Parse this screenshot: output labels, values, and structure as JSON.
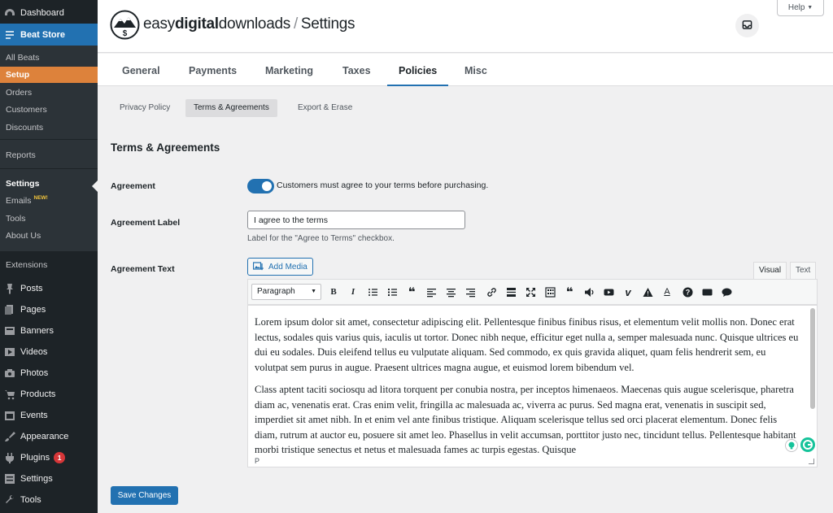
{
  "sidebar": {
    "top": [
      {
        "label": "Dashboard",
        "icon": "dashboard-icon"
      },
      {
        "label": "Beat Store",
        "icon": "store-icon"
      }
    ],
    "submenu": [
      {
        "label": "All Beats"
      },
      {
        "label": "Setup"
      },
      {
        "label": "Orders"
      },
      {
        "label": "Customers"
      },
      {
        "label": "Discounts"
      },
      {
        "label": "Reports"
      },
      {
        "label": "Settings"
      },
      {
        "label": "Emails",
        "badge": "NEW!"
      },
      {
        "label": "Tools"
      },
      {
        "label": "About Us"
      },
      {
        "label": "Extensions"
      }
    ],
    "menu": [
      {
        "label": "Posts",
        "icon": "pin-icon"
      },
      {
        "label": "Pages",
        "icon": "pages-icon"
      },
      {
        "label": "Banners",
        "icon": "banner-icon"
      },
      {
        "label": "Videos",
        "icon": "video-icon"
      },
      {
        "label": "Photos",
        "icon": "camera-icon"
      },
      {
        "label": "Products",
        "icon": "cart-icon"
      },
      {
        "label": "Events",
        "icon": "calendar-icon"
      },
      {
        "label": "Appearance",
        "icon": "brush-icon"
      },
      {
        "label": "Plugins",
        "icon": "plug-icon",
        "badge": "1"
      },
      {
        "label": "Settings",
        "icon": "settings-icon"
      },
      {
        "label": "Tools",
        "icon": "wrench-icon"
      }
    ]
  },
  "header": {
    "brand_light1": "easy",
    "brand_bold": "digital",
    "brand_light2": "downloads",
    "separator": "/",
    "page": "Settings",
    "help": "Help"
  },
  "tabs": [
    "General",
    "Payments",
    "Marketing",
    "Taxes",
    "Policies",
    "Misc"
  ],
  "subtabs": [
    "Privacy Policy",
    "Terms & Agreements",
    "Export & Erase"
  ],
  "section_title": "Terms & Agreements",
  "agreement": {
    "label": "Agreement",
    "toggle_text": "Customers must agree to your terms before purchasing.",
    "enabled": true
  },
  "agreement_label": {
    "label": "Agreement Label",
    "value": "I agree to the terms",
    "help": "Label for the \"Agree to Terms\" checkbox."
  },
  "agreement_text": {
    "label": "Agreement Text",
    "add_media": "Add Media",
    "tab_visual": "Visual",
    "tab_text": "Text",
    "format": "Paragraph",
    "paragraphs": [
      "Lorem ipsum dolor sit amet, consectetur adipiscing elit. Pellentesque finibus finibus risus, et elementum velit mollis non. Donec erat lectus, sodales quis varius quis, iaculis ut tortor. Donec nibh neque, efficitur eget nulla a, semper malesuada nunc. Quisque ultrices eu dui eu sodales. Duis eleifend tellus eu vulputate aliquam. Sed commodo, ex quis gravida aliquet, quam felis hendrerit sem, eu volutpat sem purus in augue. Praesent ultrices magna augue, et euismod lorem bibendum vel.",
      "Class aptent taciti sociosqu ad litora torquent per conubia nostra, per inceptos himenaeos. Maecenas quis augue scelerisque, pharetra diam ac, venenatis erat. Cras enim velit, fringilla ac malesuada ac, viverra ac purus. Sed magna erat, venenatis in suscipit sed, imperdiet sit amet nibh. In et enim vel ante finibus tristique. Aliquam scelerisque tellus sed orci placerat elementum. Donec felis diam, rutrum at auctor eu, posuere sit amet leo. Phasellus in velit accumsan, porttitor justo nec, tincidunt tellus. Pellentesque habitant morbi tristique senectus et netus et malesuada fames ac turpis egestas. Quisque"
    ],
    "status": "P"
  },
  "save": "Save Changes",
  "colors": {
    "accent": "#2271b1",
    "setup": "#dd823b",
    "sidebar": "#1d2327"
  }
}
